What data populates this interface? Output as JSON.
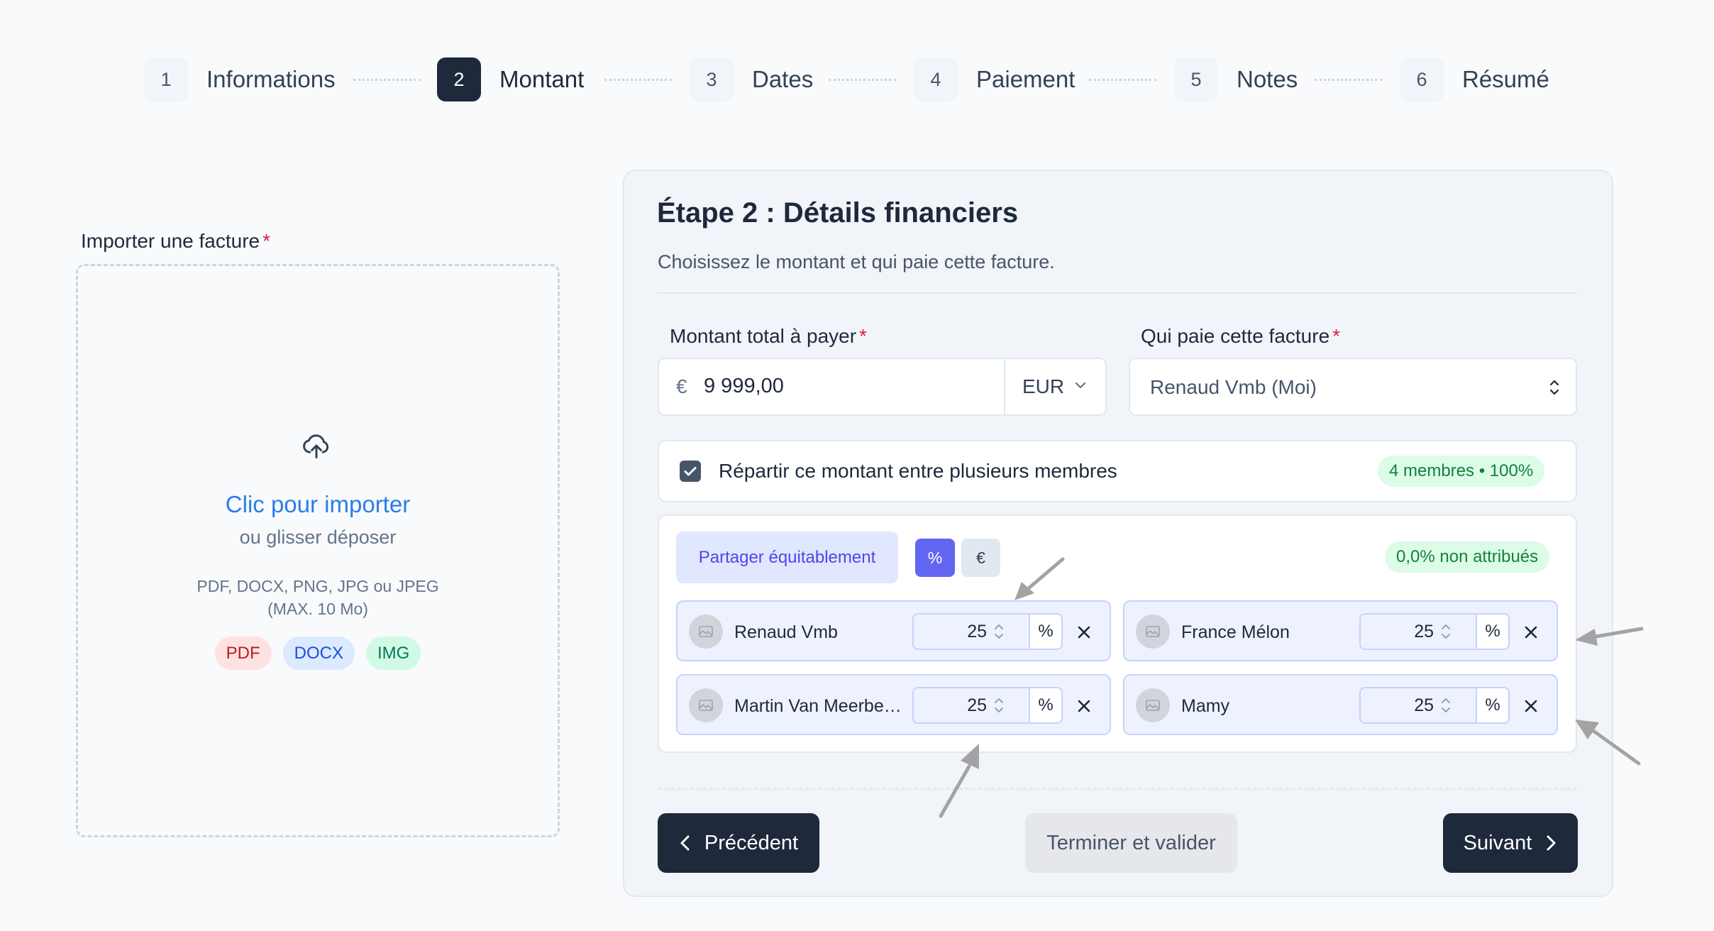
{
  "stepper": {
    "steps": [
      {
        "num": "1",
        "label": "Informations"
      },
      {
        "num": "2",
        "label": "Montant"
      },
      {
        "num": "3",
        "label": "Dates"
      },
      {
        "num": "4",
        "label": "Paiement"
      },
      {
        "num": "5",
        "label": "Notes"
      },
      {
        "num": "6",
        "label": "Résumé"
      }
    ],
    "active_step": 2
  },
  "upload": {
    "label": "Importer une facture",
    "required_mark": "*",
    "click_text": "Clic pour importer",
    "drag_text": "ou glisser déposer",
    "formats_line1": "PDF, DOCX, PNG, JPG ou JPEG",
    "formats_line2": "(MAX. 10 Mo)",
    "chips": [
      "PDF",
      "DOCX",
      "IMG"
    ]
  },
  "panel": {
    "title": "Étape 2 : Détails financiers",
    "subtitle": "Choisissez le montant et qui paie cette facture."
  },
  "amount": {
    "label": "Montant total à payer",
    "required_mark": "*",
    "currency_symbol": "€",
    "value": "9 999,00",
    "currency": "EUR"
  },
  "payer": {
    "label": "Qui paie cette facture",
    "required_mark": "*",
    "value": "Renaud Vmb (Moi)"
  },
  "split": {
    "checked": true,
    "label": "Répartir ce montant entre plusieurs membres",
    "badge": "4 membres • 100%"
  },
  "members_panel": {
    "equal_button": "Partager équitablement",
    "mode_percent": "%",
    "mode_euro": "€",
    "unassigned_badge": "0,0% non attribués",
    "members": [
      {
        "name": "Renaud Vmb",
        "value": "25",
        "unit": "%"
      },
      {
        "name": "France Mélon",
        "value": "25",
        "unit": "%"
      },
      {
        "name": "Martin Van Meerbergen",
        "value": "25",
        "unit": "%"
      },
      {
        "name": "Mamy",
        "value": "25",
        "unit": "%"
      }
    ]
  },
  "nav": {
    "prev_label": "Précédent",
    "finish_label": "Terminer et valider",
    "next_label": "Suivant"
  },
  "colors": {
    "primary_dark": "#1e293b",
    "accent_indigo": "#6366f1",
    "link_blue": "#2b7de9",
    "success_green": "#15803d",
    "required_red": "#e11d48"
  }
}
